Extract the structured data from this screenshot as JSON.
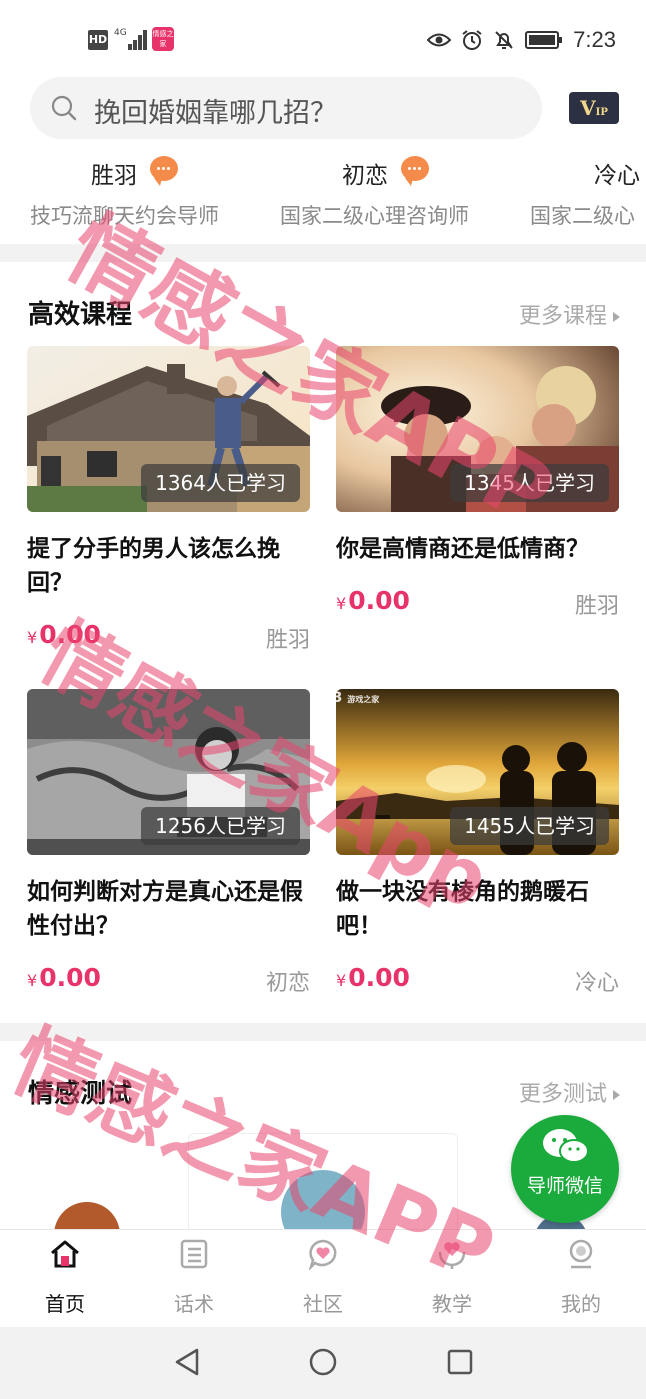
{
  "status_bar": {
    "hd": "HD",
    "network": "4G",
    "app_icon_text": "情感之家",
    "time": "7:23"
  },
  "search": {
    "placeholder": "挽回婚姻靠哪几招？",
    "vip_label": "V",
    "vip_sub": "IP"
  },
  "mentors": [
    {
      "name": "胜羽",
      "desc": "技巧流聊天约会导师"
    },
    {
      "name": "初恋",
      "desc": "国家二级心理咨询师"
    },
    {
      "name": "冷心",
      "desc": "国家二级心"
    }
  ],
  "courses_section": {
    "title": "高效课程",
    "more": "更多课程"
  },
  "courses": [
    {
      "learners": "1364人已学习",
      "title": "提了分手的男人该怎么挽回？",
      "price": "0.00",
      "currency": "¥",
      "author": "胜羽"
    },
    {
      "learners": "1345人已学习",
      "title": "你是高情商还是低情商？",
      "price": "0.00",
      "currency": "¥",
      "author": "胜羽"
    },
    {
      "learners": "1256人已学习",
      "title": "如何判断对方是真心还是假性付出？",
      "price": "0.00",
      "currency": "¥",
      "author": "初恋"
    },
    {
      "learners": "1455人已学习",
      "title": "做一块没有棱角的鹅暖石吧！",
      "price": "0.00",
      "currency": "¥",
      "author": "冷心"
    }
  ],
  "tests_section": {
    "title": "情感测试",
    "more": "更多测试"
  },
  "wechat_fab": {
    "label": "导师微信"
  },
  "tabbar": [
    {
      "label": "首页",
      "icon": "home-icon",
      "active": true
    },
    {
      "label": "话术",
      "icon": "list-icon",
      "active": false
    },
    {
      "label": "社区",
      "icon": "community-icon",
      "active": false
    },
    {
      "label": "教学",
      "icon": "teach-icon",
      "active": false
    },
    {
      "label": "我的",
      "icon": "profile-icon",
      "active": false
    }
  ],
  "watermark": {
    "line1": "情感之家APP",
    "line2": "情感之家App",
    "line3": "情感之家APP",
    "k73": "K73",
    "k73_sub": "游戏之家"
  },
  "colors": {
    "accent": "#e8336a",
    "wechat": "#1aab3c",
    "vip_bg": "#2b3142",
    "bubble": "#f58b4b"
  }
}
